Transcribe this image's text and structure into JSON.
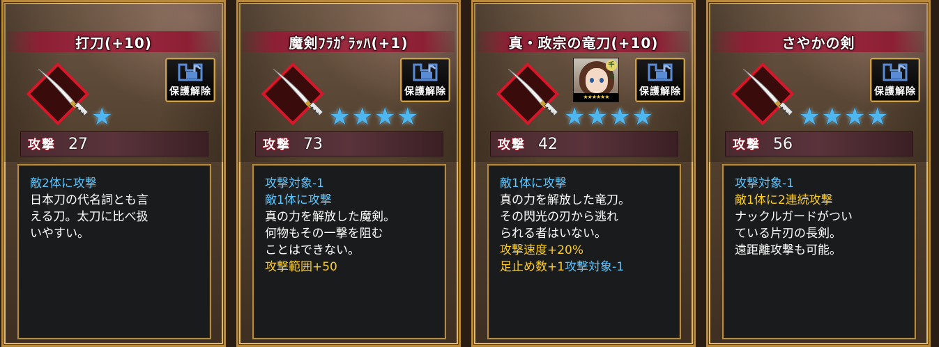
{
  "cards": [
    {
      "title": "打刀(+10)",
      "stars": 1,
      "has_portrait": false,
      "lock_label": "保護解除",
      "stat_label": "攻撃",
      "stat_value": "27",
      "desc": [
        [
          {
            "t": "敵2体に攻撃",
            "c": "blue"
          }
        ],
        [
          {
            "t": "日本刀の代名詞とも言",
            "c": "white"
          }
        ],
        [
          {
            "t": "える刀。太刀に比べ扱",
            "c": "white"
          }
        ],
        [
          {
            "t": "いやすい。",
            "c": "white"
          }
        ]
      ]
    },
    {
      "title": "魔剣ﾌﾗｶﾞﾗｯﾊ(+1)",
      "stars": 4,
      "has_portrait": false,
      "lock_label": "保護解除",
      "stat_label": "攻撃",
      "stat_value": "73",
      "desc": [
        [
          {
            "t": "攻撃対象-1",
            "c": "blue"
          }
        ],
        [
          {
            "t": "敵1体に攻撃",
            "c": "blue"
          }
        ],
        [
          {
            "t": "真の力を解放した魔剣。",
            "c": "white"
          }
        ],
        [
          {
            "t": "何物もその一撃を阻む",
            "c": "white"
          }
        ],
        [
          {
            "t": "ことはできない。",
            "c": "white"
          }
        ],
        [
          {
            "t": "攻撃範囲+50",
            "c": "yellow"
          }
        ]
      ]
    },
    {
      "title": "真・政宗の竜刀(+10)",
      "stars": 4,
      "has_portrait": true,
      "portrait": {
        "badge": "千山",
        "rank": "★★★★★★"
      },
      "lock_label": "保護解除",
      "stat_label": "攻撃",
      "stat_value": "42",
      "desc": [
        [
          {
            "t": "敵1体に攻撃",
            "c": "blue"
          }
        ],
        [
          {
            "t": "真の力を解放した竜刀。",
            "c": "white"
          }
        ],
        [
          {
            "t": "その閃光の刃から逃れ",
            "c": "white"
          }
        ],
        [
          {
            "t": "られる者はいない。",
            "c": "white"
          }
        ],
        [
          {
            "t": "攻撃速度+20%",
            "c": "yellow"
          }
        ],
        [
          {
            "t": "足止め数+1",
            "c": "yellow"
          },
          {
            "t": "攻撃対象-1",
            "c": "blue"
          }
        ]
      ]
    },
    {
      "title": "さやかの剣",
      "stars": 4,
      "has_portrait": false,
      "lock_label": "保護解除",
      "stat_label": "攻撃",
      "stat_value": "56",
      "desc": [
        [
          {
            "t": "攻撃対象-1",
            "c": "blue"
          }
        ],
        [
          {
            "t": "敵1体に2連続攻撃",
            "c": "yellow"
          }
        ],
        [
          {
            "t": "ナックルガードがつい",
            "c": "white"
          }
        ],
        [
          {
            "t": "ている片刃の長剣。",
            "c": "white"
          }
        ],
        [
          {
            "t": "遠距離攻撃も可能。",
            "c": "white"
          }
        ]
      ]
    }
  ],
  "colors": {
    "blue": "#5cc6ff",
    "yellow": "#ffcc22",
    "white": "#ffffff",
    "star": "#4fb7f0"
  },
  "icons": {
    "weapon": "katana-icon",
    "lock": "unlock-icon",
    "star": "star-icon"
  }
}
